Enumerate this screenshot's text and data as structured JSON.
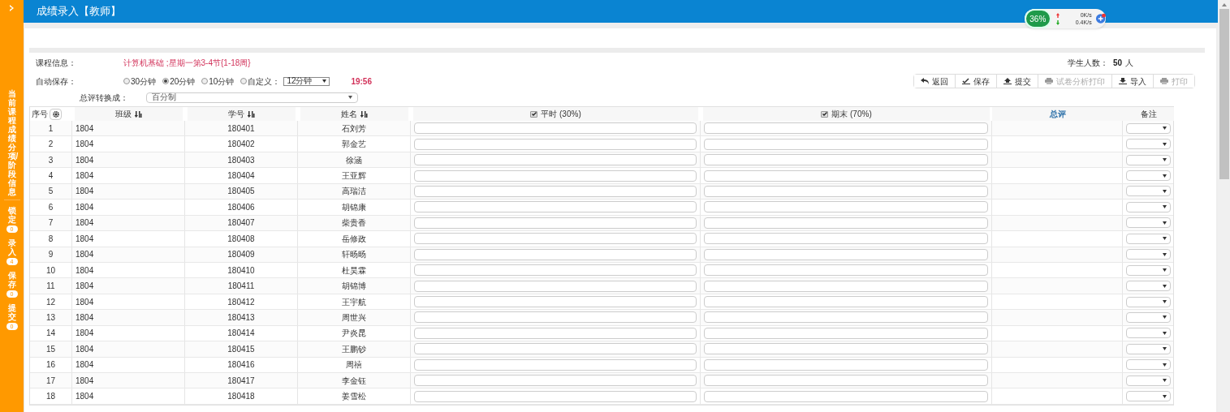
{
  "header": {
    "title": "成绩录入【教师】"
  },
  "sidebar": {
    "title": "当前课程成绩分项/阶段信息",
    "items": [
      {
        "label": "锁定",
        "count": "0"
      },
      {
        "label": "录入",
        "count": "4"
      },
      {
        "label": "保存",
        "count": "0"
      },
      {
        "label": "提交",
        "count": "0"
      }
    ]
  },
  "net_widget": {
    "usage": "36%",
    "upload": "0K/s",
    "download": "0.4K/s"
  },
  "course": {
    "label": "课程信息：",
    "value": "计算机基础 ;星期一第3-4节{1-18周}",
    "count_label": "学生人数：",
    "count": "50",
    "count_unit": "人"
  },
  "autosave": {
    "label": "自动保存：",
    "options": [
      {
        "label": "30分钟",
        "selected": false
      },
      {
        "label": "20分钟",
        "selected": true
      },
      {
        "label": "10分钟",
        "selected": false
      },
      {
        "label": "自定义：",
        "selected": false
      }
    ],
    "custom_value": "12分钟",
    "time": "19:56"
  },
  "conversion": {
    "label": "总评转换成：",
    "value": "百分制"
  },
  "toolbar": [
    {
      "label": "返回",
      "kind": "back",
      "disabled": false
    },
    {
      "label": "保存",
      "kind": "save",
      "disabled": false
    },
    {
      "label": "提交",
      "kind": "upload",
      "disabled": false
    },
    {
      "label": "试卷分析打印",
      "kind": "print",
      "disabled": true
    },
    {
      "label": "导入",
      "kind": "import",
      "disabled": false
    },
    {
      "label": "打印",
      "kind": "print",
      "disabled": true
    }
  ],
  "table": {
    "columns": [
      {
        "label": "序号",
        "kind": "gear"
      },
      {
        "label": "班级",
        "kind": "sort"
      },
      {
        "label": "学号",
        "kind": "sort"
      },
      {
        "label": "姓名",
        "kind": "sort"
      },
      {
        "label": "平时 (30%)",
        "kind": "check",
        "checked": true
      },
      {
        "label": "期末 (70%)",
        "kind": "check",
        "checked": true
      },
      {
        "label": "总评",
        "kind": "total"
      },
      {
        "label": "备注",
        "kind": "plain"
      }
    ],
    "rows": [
      {
        "no": "1",
        "class": "1804",
        "id": "180401",
        "name": "石刘芳"
      },
      {
        "no": "2",
        "class": "1804",
        "id": "180402",
        "name": "郭金艺"
      },
      {
        "no": "3",
        "class": "1804",
        "id": "180403",
        "name": "徐涵"
      },
      {
        "no": "4",
        "class": "1804",
        "id": "180404",
        "name": "王亚辉"
      },
      {
        "no": "5",
        "class": "1804",
        "id": "180405",
        "name": "高瑞洁"
      },
      {
        "no": "6",
        "class": "1804",
        "id": "180406",
        "name": "胡锦康"
      },
      {
        "no": "7",
        "class": "1804",
        "id": "180407",
        "name": "柴贵香"
      },
      {
        "no": "8",
        "class": "1804",
        "id": "180408",
        "name": "岳修政"
      },
      {
        "no": "9",
        "class": "1804",
        "id": "180409",
        "name": "轩旸旸"
      },
      {
        "no": "10",
        "class": "1804",
        "id": "180410",
        "name": "杜昊霖"
      },
      {
        "no": "11",
        "class": "1804",
        "id": "180411",
        "name": "胡锦博"
      },
      {
        "no": "12",
        "class": "1804",
        "id": "180412",
        "name": "王宇航"
      },
      {
        "no": "13",
        "class": "1804",
        "id": "180413",
        "name": "周世兴"
      },
      {
        "no": "14",
        "class": "1804",
        "id": "180414",
        "name": "尹炎昆"
      },
      {
        "no": "15",
        "class": "1804",
        "id": "180415",
        "name": "王鹏钞"
      },
      {
        "no": "16",
        "class": "1804",
        "id": "180416",
        "name": "周禧"
      },
      {
        "no": "17",
        "class": "1804",
        "id": "180417",
        "name": "李金钰"
      },
      {
        "no": "18",
        "class": "1804",
        "id": "180418",
        "name": "姜雪松"
      }
    ]
  }
}
